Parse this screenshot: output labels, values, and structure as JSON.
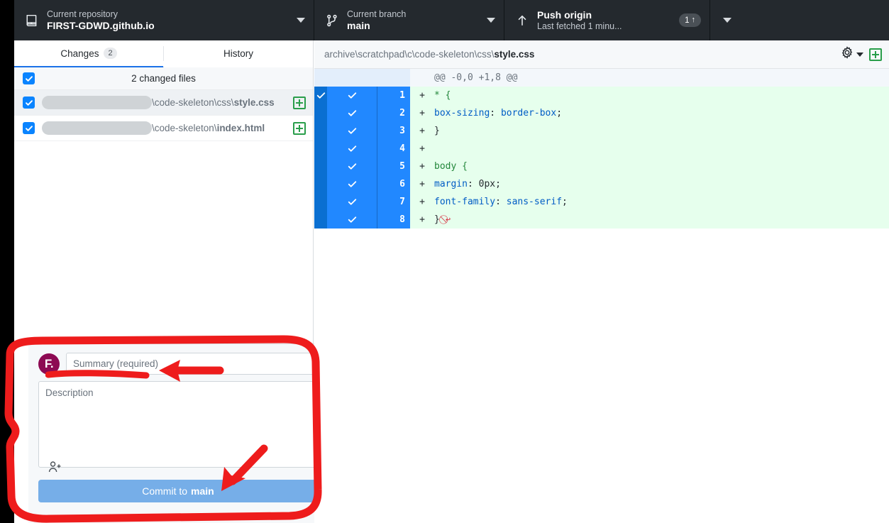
{
  "toolbar": {
    "repo": {
      "icon": "repository-icon",
      "label": "Current repository",
      "value": "FIRST-GDWD.github.io"
    },
    "branch": {
      "icon": "branch-icon",
      "label": "Current branch",
      "value": "main"
    },
    "push": {
      "icon": "arrow-up-icon",
      "title": "Push origin",
      "subtitle": "Last fetched 1 minu...",
      "badge_count": "1",
      "badge_arrow": "↑"
    }
  },
  "left": {
    "tabs": [
      {
        "label": "Changes",
        "count": "2",
        "active": true
      },
      {
        "label": "History",
        "count": "",
        "active": false
      }
    ],
    "files_header": "2 changed files",
    "files": [
      {
        "redacted": true,
        "path_prefix": "\\code-skeleton\\css\\",
        "path_name": "style.css",
        "status": "added",
        "checked": true
      },
      {
        "redacted": true,
        "path_prefix": "\\code-skeleton\\",
        "path_name": "index.html",
        "status": "added",
        "checked": true
      }
    ]
  },
  "commit": {
    "avatar_initials": "F.",
    "avatar_color": "#8d0a53",
    "summary_placeholder": "Summary (required)",
    "summary_value": "",
    "description_placeholder": "Description",
    "description_value": "",
    "coauthor_icon": "add-coauthor-icon",
    "button_prefix": "Commit to ",
    "button_branch": "main"
  },
  "diff": {
    "file_path_prefix": "archive\\scratchpad\\c\\code-skeleton\\css\\",
    "file_path_name": "style.css",
    "gear_icon": "gear-icon",
    "expand_icon": "add-icon",
    "hunk_header": "@@ -0,0 +1,8 @@",
    "lines": [
      {
        "num": "1",
        "marker": "+",
        "tokens": [
          {
            "t": "* {",
            "c": "tok-sel"
          }
        ]
      },
      {
        "num": "2",
        "marker": "+",
        "tokens": [
          {
            "t": "    ",
            "c": ""
          },
          {
            "t": "box-sizing",
            "c": "tok-prop"
          },
          {
            "t": ": ",
            "c": "tok-punct"
          },
          {
            "t": "border-box",
            "c": "tok-val"
          },
          {
            "t": ";",
            "c": "tok-punct"
          }
        ]
      },
      {
        "num": "3",
        "marker": "+",
        "tokens": [
          {
            "t": "}",
            "c": "tok-punct"
          }
        ]
      },
      {
        "num": "4",
        "marker": "+",
        "tokens": [
          {
            "t": "",
            "c": ""
          }
        ]
      },
      {
        "num": "5",
        "marker": "+",
        "tokens": [
          {
            "t": "body {",
            "c": "tok-sel"
          }
        ]
      },
      {
        "num": "6",
        "marker": "+",
        "tokens": [
          {
            "t": "    ",
            "c": ""
          },
          {
            "t": "margin",
            "c": "tok-prop"
          },
          {
            "t": ": ",
            "c": "tok-punct"
          },
          {
            "t": "0px",
            "c": "tok-punct"
          },
          {
            "t": ";",
            "c": "tok-punct"
          }
        ]
      },
      {
        "num": "7",
        "marker": "+",
        "tokens": [
          {
            "t": "    ",
            "c": ""
          },
          {
            "t": "font-family",
            "c": "tok-prop"
          },
          {
            "t": ": ",
            "c": "tok-punct"
          },
          {
            "t": "sans-serif",
            "c": "tok-val"
          },
          {
            "t": ";",
            "c": "tok-punct"
          }
        ]
      },
      {
        "num": "8",
        "marker": "+",
        "tokens": [
          {
            "t": "}",
            "c": "tok-punct"
          }
        ],
        "no_newline": true
      }
    ]
  },
  "annotations": {
    "color": "#ee1c1c",
    "items": [
      {
        "name": "highlight-box-commit-area"
      },
      {
        "name": "arrow-pointing-to-summary"
      },
      {
        "name": "underline-summary-placeholder"
      },
      {
        "name": "arrow-pointing-to-commit-button"
      }
    ]
  }
}
